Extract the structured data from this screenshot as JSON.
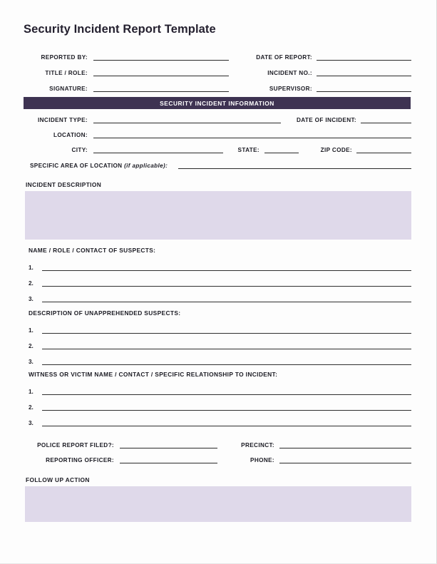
{
  "document": {
    "title": "Security Incident Report Template"
  },
  "colors": {
    "section_bar_bg": "#3E3352",
    "section_bar_text": "#FFFFFF",
    "textarea_fill": "#DFD9EA",
    "rule": "#2A2A2A",
    "page_bg": "#FDFDFD",
    "label_text": "#1C1C24"
  },
  "header_fields": {
    "left": [
      {
        "label": "REPORTED BY:"
      },
      {
        "label": "TITLE / ROLE:"
      },
      {
        "label": "SIGNATURE:"
      }
    ],
    "right": [
      {
        "label": "DATE OF REPORT:"
      },
      {
        "label": "INCIDENT NO.:"
      },
      {
        "label": "SUPERVISOR:"
      }
    ]
  },
  "section_bar": {
    "label": "SECURITY INCIDENT INFORMATION"
  },
  "incident_fields": {
    "incident_type": {
      "label": "INCIDENT TYPE:",
      "value": ""
    },
    "date_of_incident": {
      "label": "DATE OF INCIDENT:",
      "value": ""
    },
    "location": {
      "label": "LOCATION:",
      "value": ""
    },
    "city": {
      "label": "CITY:",
      "value": ""
    },
    "state": {
      "label": "STATE:",
      "value": ""
    },
    "zip_code": {
      "label": "ZIP CODE:",
      "value": ""
    },
    "specific_area": {
      "label": "SPECIFIC AREA OF LOCATION",
      "label_italic": "(if applicable):",
      "value": ""
    }
  },
  "incident_description": {
    "heading": "INCIDENT DESCRIPTION",
    "value": ""
  },
  "suspects": {
    "heading": "NAME / ROLE / CONTACT OF SUSPECTS:",
    "rows": [
      {
        "number": "1.",
        "value": ""
      },
      {
        "number": "2.",
        "value": ""
      },
      {
        "number": "3.",
        "value": ""
      }
    ]
  },
  "unapprehended": {
    "heading": "DESCRIPTION OF UNAPPREHENDED SUSPECTS:",
    "rows": [
      {
        "number": "1.",
        "value": ""
      },
      {
        "number": "2.",
        "value": ""
      },
      {
        "number": "3.",
        "value": ""
      }
    ]
  },
  "witnesses": {
    "heading": "WITNESS OR VICTIM NAME / CONTACT / SPECIFIC RELATIONSHIP TO INCIDENT:",
    "rows": [
      {
        "number": "1.",
        "value": ""
      },
      {
        "number": "2.",
        "value": ""
      },
      {
        "number": "3.",
        "value": ""
      }
    ]
  },
  "police": {
    "report_filed": {
      "label": "POLICE REPORT FILED?:",
      "value": ""
    },
    "precinct": {
      "label": "PRECINCT:",
      "value": ""
    },
    "reporting_officer": {
      "label": "REPORTING OFFICER:",
      "value": ""
    },
    "phone": {
      "label": "PHONE:",
      "value": ""
    }
  },
  "follow_up": {
    "heading": "FOLLOW UP ACTION",
    "value": ""
  }
}
